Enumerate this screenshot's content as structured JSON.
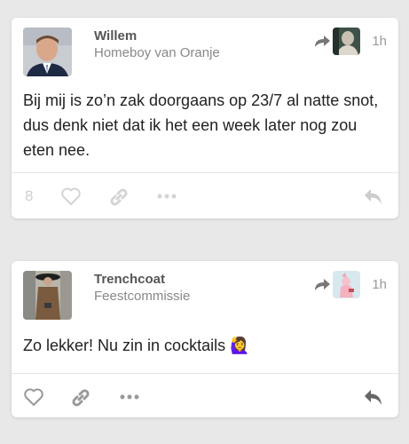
{
  "posts": [
    {
      "username": "Willem",
      "user_title": "Homeboy van Oranje",
      "time": "1h",
      "body": "Bij mij is zo’n zak doorgaans op 23/7 al natte snot, dus denk niet dat ik het een week later nog zou eten nee.",
      "like_count": "8"
    },
    {
      "username": "Trenchcoat",
      "user_title": "Feestcommissie",
      "time": "1h",
      "body": "Zo lekker! Nu zin in cocktails",
      "emoji": "🙋‍♀️"
    }
  ],
  "colors": {
    "background": "#e8e8e8",
    "card": "#ffffff",
    "muted_icon": "#cccccc",
    "active_icon": "#999999"
  },
  "icons": [
    "reply-arrow-icon",
    "heart-icon",
    "link-icon",
    "more-icon",
    "reply-icon"
  ]
}
